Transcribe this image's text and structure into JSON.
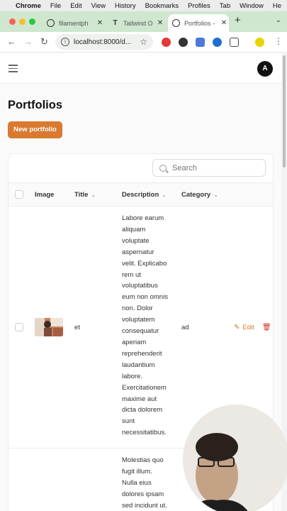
{
  "menubar": {
    "items": [
      "Chrome",
      "File",
      "Edit",
      "View",
      "History",
      "Bookmarks",
      "Profiles",
      "Tab",
      "Window",
      "He"
    ]
  },
  "tabs": [
    {
      "title": "filamentph",
      "icon": "github-icon",
      "active": false
    },
    {
      "title": "Tailwind O",
      "icon": "tailwind-icon",
      "active": false
    },
    {
      "title": "Portfolios -",
      "icon": "globe-icon",
      "active": true
    }
  ],
  "toolbar": {
    "url": "localhost:8000/d..."
  },
  "page": {
    "title": "Portfolios",
    "new_button": "New portfolio",
    "search_placeholder": "Search",
    "avatar_initial": "A",
    "columns": {
      "image": "Image",
      "title": "Title",
      "description": "Description",
      "category": "Category"
    },
    "rows": [
      {
        "title": "et",
        "description": "Labore earum\naliquam\nvoluptate\naspernatur\nvelit. Explicabo\nrem ut\nvoluptatibus\neum non omnis\nnon. Dolor\nvoluptatem\nconsequatur\naperiam\nreprehenderit\nlaudantium\nlabore.\nExercitationem\nmaxime aut\ndicta dolorem\nsunt\nnecessitatibus.",
        "category": "ad",
        "edit": "Edit",
        "delete": "D"
      },
      {
        "title": "",
        "description": "Molestias quo\nfugit illum.\nNulla eius\ndolores ipsam\nsed incidunt ut.",
        "category": "",
        "edit": "",
        "delete": ""
      }
    ]
  },
  "colors": {
    "primary": "#d97a30",
    "danger": "#dc2626",
    "tabstrip": "#cfe6cf"
  }
}
